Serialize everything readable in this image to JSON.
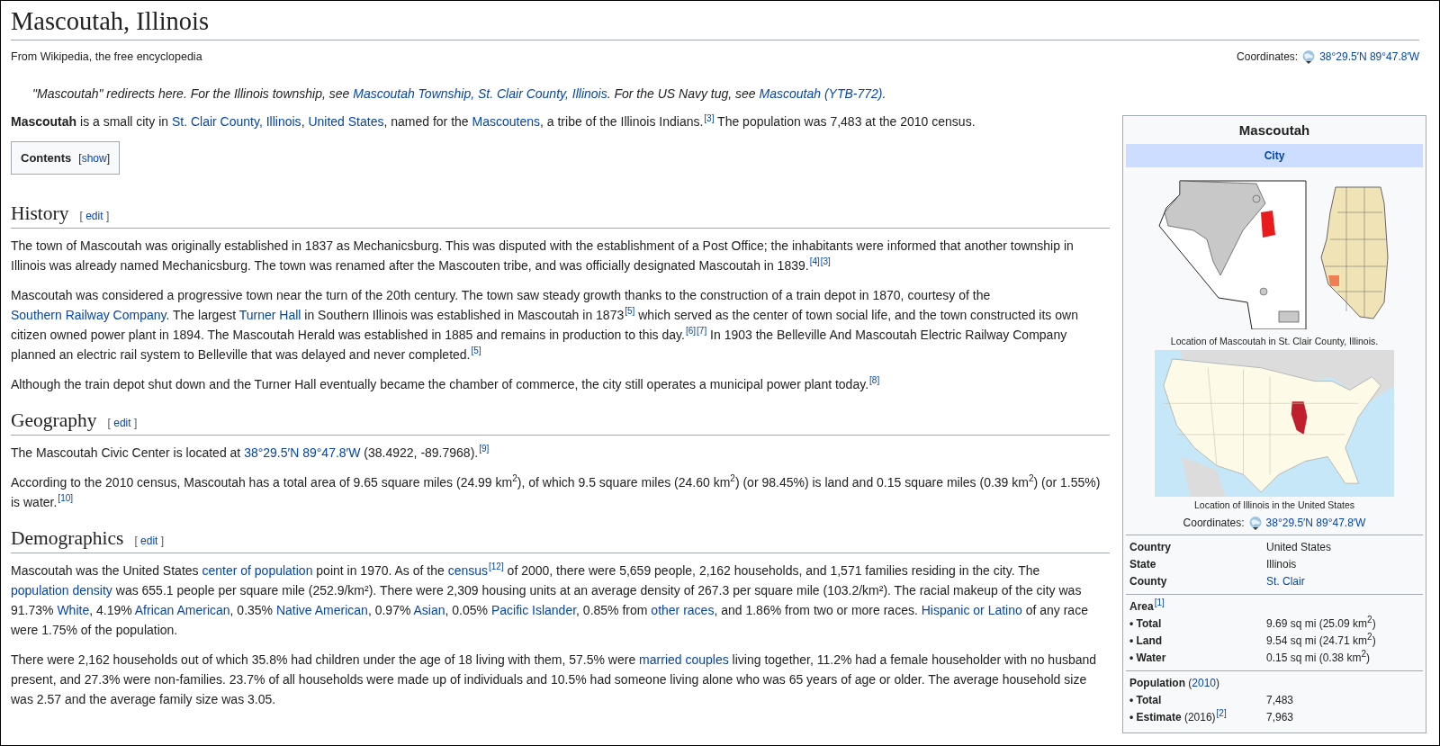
{
  "title": "Mascoutah, Illinois",
  "tagline": "From Wikipedia, the free encyclopedia",
  "coordinates": {
    "label": "Coordinates:",
    "link": "38°29.5′N 89°47.8′W"
  },
  "hatnote": [
    {
      "kind": "text",
      "text": "\"Mascoutah\" redirects here. For the Illinois township, see "
    },
    {
      "kind": "link",
      "text": "Mascoutah Township, St. Clair County, Illinois"
    },
    {
      "kind": "text",
      "text": ". For the US Navy tug, see "
    },
    {
      "kind": "link",
      "text": "Mascoutah (YTB-772)"
    },
    {
      "kind": "text",
      "text": "."
    }
  ],
  "lead": [
    {
      "kind": "text",
      "text": "**Mascoutah** is a small city in "
    },
    {
      "kind": "link",
      "text": "St. Clair County, Illinois"
    },
    {
      "kind": "text",
      "text": ", "
    },
    {
      "kind": "link",
      "text": "United States"
    },
    {
      "kind": "text",
      "text": ", named for the "
    },
    {
      "kind": "link",
      "text": "Mascoutens"
    },
    {
      "kind": "text",
      "text": ", a tribe of the Illinois Indians."
    },
    {
      "kind": "ref",
      "text": "[3]"
    },
    {
      "kind": "text",
      "text": " The population was 7,483 at the 2010 census."
    }
  ],
  "contents": {
    "title": "Contents",
    "toggle": [
      "[",
      "show",
      "]"
    ]
  },
  "sections": [
    {
      "heading": "History",
      "edit": [
        "[",
        "edit",
        "]"
      ],
      "paragraphs": [
        [
          {
            "kind": "text",
            "text": "The town of Mascoutah was originally established in 1837 as Mechanicsburg. This was disputed with the establishment of a Post Office; the inhabitants were informed that another township in Illinois was already named Mechanicsburg. The town was renamed after the Mascouten tribe, and was officially designated Mascoutah in 1839."
          },
          {
            "kind": "ref",
            "text": "[4]"
          },
          {
            "kind": "ref",
            "text": "[3]"
          }
        ],
        [
          {
            "kind": "text",
            "text": "Mascoutah was considered a progressive town near the turn of the 20th century. The town saw steady growth thanks to the construction of a train depot in 1870, courtesy of the "
          },
          {
            "kind": "link",
            "text": "Southern Railway Company"
          },
          {
            "kind": "text",
            "text": ". The largest "
          },
          {
            "kind": "link",
            "text": "Turner Hall"
          },
          {
            "kind": "text",
            "text": " in Southern Illinois was established in Mascoutah in 1873"
          },
          {
            "kind": "ref",
            "text": "[5]"
          },
          {
            "kind": "text",
            "text": " which served as the center of town social life, and the town constructed its own citizen owned power plant in 1894. The Mascoutah Herald was established in 1885 and remains in production to this day."
          },
          {
            "kind": "ref",
            "text": "[6]"
          },
          {
            "kind": "ref",
            "text": "[7]"
          },
          {
            "kind": "text",
            "text": " In 1903 the Belleville And Mascoutah Electric Railway Company planned an electric rail system to Belleville that was delayed and never completed."
          },
          {
            "kind": "ref",
            "text": "[5]"
          }
        ],
        [
          {
            "kind": "text",
            "text": "Although the train depot shut down and the Turner Hall eventually became the chamber of commerce, the city still operates a municipal power plant today."
          },
          {
            "kind": "ref",
            "text": "[8]"
          }
        ]
      ]
    },
    {
      "heading": "Geography",
      "edit": [
        "[",
        "edit",
        "]"
      ],
      "paragraphs": [
        [
          {
            "kind": "text",
            "text": "The Mascoutah Civic Center is located at "
          },
          {
            "kind": "link",
            "text": "38°29.5′N 89°47.8′W"
          },
          {
            "kind": "text",
            "text": " (38.4922, -89.7968)."
          },
          {
            "kind": "ref",
            "text": "[9]"
          }
        ],
        [
          {
            "kind": "text",
            "text": "According to the 2010 census, Mascoutah has a total area of 9.65 square miles (24.99 km$^{2}$), of which 9.5 square miles (24.60 km$^{2}$) (or 98.45%) is land and 0.15 square miles (0.39 km$^{2}$) (or 1.55%) is water."
          },
          {
            "kind": "ref",
            "text": "[10]"
          }
        ]
      ]
    },
    {
      "heading": "Demographics",
      "edit": [
        "[",
        "edit",
        "]"
      ],
      "paragraphs": [
        [
          {
            "kind": "text",
            "text": "Mascoutah was the United States "
          },
          {
            "kind": "link",
            "text": "center of population"
          },
          {
            "kind": "text",
            "text": " point in 1970. As of the "
          },
          {
            "kind": "link",
            "text": "census"
          },
          {
            "kind": "ref",
            "text": "[12]"
          },
          {
            "kind": "text",
            "text": " of 2000, there were 5,659 people, 2,162 households, and 1,571 families residing in the city. The "
          },
          {
            "kind": "link",
            "text": "population density"
          },
          {
            "kind": "text",
            "text": " was 655.1 people per square mile (252.9/km²). There were 2,309 housing units at an average density of 267.3 per square mile (103.2/km²). The racial makeup of the city was 91.73% "
          },
          {
            "kind": "link",
            "text": "White"
          },
          {
            "kind": "text",
            "text": ", 4.19% "
          },
          {
            "kind": "link",
            "text": "African American"
          },
          {
            "kind": "text",
            "text": ", 0.35% "
          },
          {
            "kind": "link",
            "text": "Native American"
          },
          {
            "kind": "text",
            "text": ", 0.97% "
          },
          {
            "kind": "link",
            "text": "Asian"
          },
          {
            "kind": "text",
            "text": ", 0.05% "
          },
          {
            "kind": "link",
            "text": "Pacific Islander"
          },
          {
            "kind": "text",
            "text": ", 0.85% from "
          },
          {
            "kind": "link",
            "text": "other races"
          },
          {
            "kind": "text",
            "text": ", and 1.86% from two or more races. "
          },
          {
            "kind": "link",
            "text": "Hispanic or Latino"
          },
          {
            "kind": "text",
            "text": " of any race were 1.75% of the population."
          }
        ],
        [
          {
            "kind": "text",
            "text": "There were 2,162 households out of which 35.8% had children under the age of 18 living with them, 57.5% were "
          },
          {
            "kind": "link",
            "text": "married couples"
          },
          {
            "kind": "text",
            "text": " living together, 11.2% had a female householder with no husband present, and 27.3% were non-families. 23.7% of all households were made up of individuals and 10.5% had someone living alone who was 65 years of age or older. The average household size was 2.57 and the average family size was 3.05."
          }
        ]
      ]
    }
  ],
  "infobox": {
    "title": "Mascoutah",
    "subtitle": "City",
    "map_caption": "Location of Mascoutah in St. Clair County, Illinois.",
    "us_map_caption": "Location of Illinois in the United States",
    "coordinates": {
      "label": "Coordinates:",
      "link": "38°29.5′N 89°47.8′W"
    },
    "groups": [
      {
        "rows": [
          {
            "kind": "text",
            "label": "Country",
            "value": "United States"
          },
          {
            "kind": "text",
            "label": "State",
            "value": "Illinois"
          },
          {
            "kind": "link",
            "label": "County",
            "value": "St. Clair"
          }
        ]
      },
      {
        "rows": [
          {
            "kind": "header",
            "label": "Area",
            "suffix": [
              {
                "kind": "ref",
                "text": "[1]"
              }
            ]
          },
          {
            "kind": "text",
            "label": "• Total",
            "value": "9.69 sq mi (25.09 km$^{2}$)"
          },
          {
            "kind": "text",
            "label": "• Land",
            "value": "9.54 sq mi (24.71 km$^{2}$)"
          },
          {
            "kind": "text",
            "label": "• Water",
            "value": "0.15 sq mi (0.38 km$^{2}$)"
          }
        ]
      },
      {
        "rows": [
          {
            "kind": "header",
            "label": "Population",
            "suffix": [
              {
                "kind": "text",
                "text": " ("
              },
              {
                "kind": "link",
                "text": "2010"
              },
              {
                "kind": "text",
                "text": ")"
              }
            ]
          },
          {
            "kind": "text",
            "label": "• Total",
            "value": "7,483"
          },
          {
            "kind": "text",
            "label": "• Estimate",
            "suffix": [
              {
                "kind": "text",
                "text": " (2016)"
              },
              {
                "kind": "ref",
                "text": "[2]"
              }
            ],
            "value": "7,963"
          }
        ]
      }
    ]
  }
}
